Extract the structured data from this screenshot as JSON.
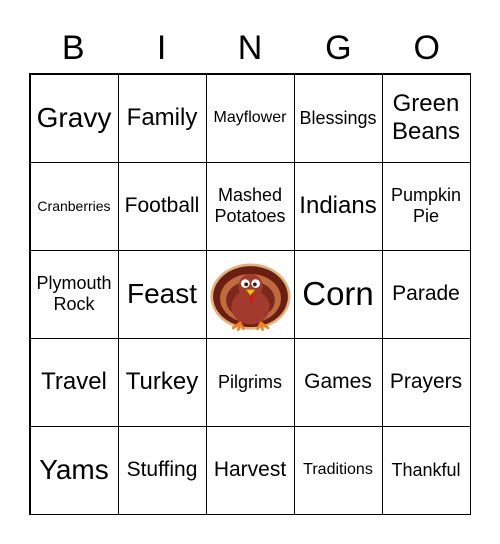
{
  "header": [
    "B",
    "I",
    "N",
    "G",
    "O"
  ],
  "cells": [
    "Gravy",
    "Family",
    "Mayflower",
    "Blessings",
    "Green\nBeans",
    "Cranberries",
    "Football",
    "Mashed\nPotatoes",
    "Indians",
    "Pumpkin\nPie",
    "Plymouth\nRock",
    "Feast",
    "",
    "Corn",
    "Parade",
    "Travel",
    "Turkey",
    "Pilgrims",
    "Games",
    "Prayers",
    "Yams",
    "Stuffing",
    "Harvest",
    "Traditions",
    "Thankful"
  ],
  "free_space_icon": "turkey-icon"
}
